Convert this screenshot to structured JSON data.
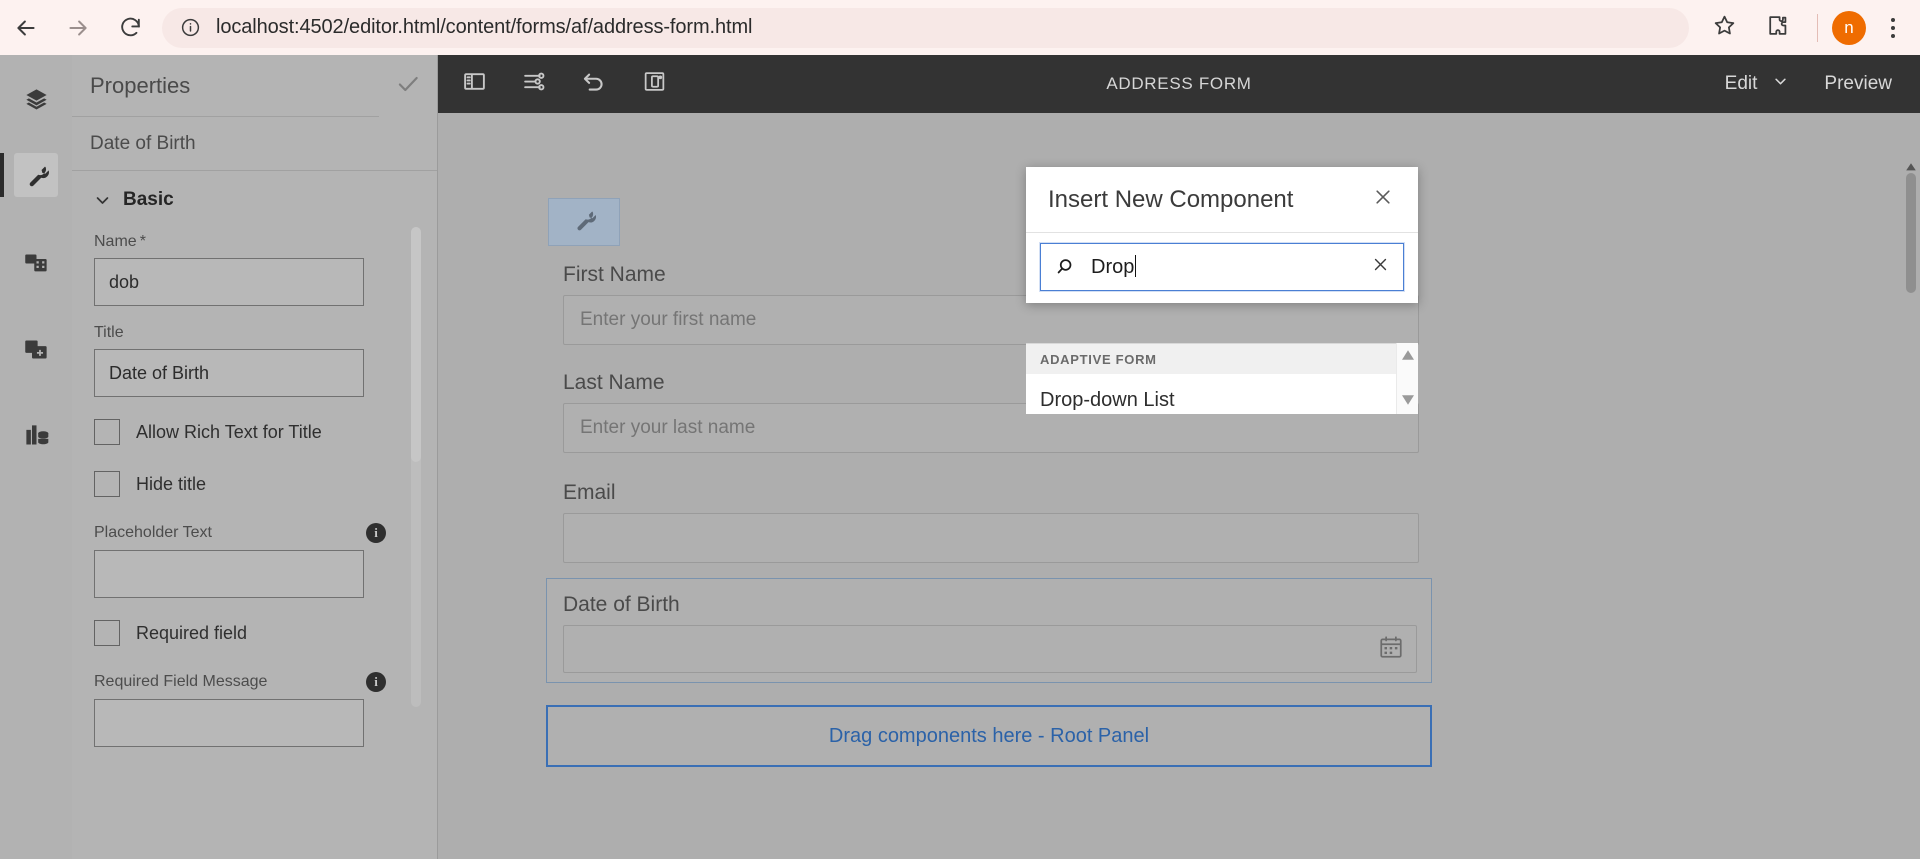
{
  "browser": {
    "url": "localhost:4502/editor.html/content/forms/af/address-form.html",
    "back_icon": "back-arrow-icon",
    "forward_icon": "forward-arrow-icon",
    "reload_icon": "reload-icon",
    "info_icon": "site-info-icon",
    "bookmark_icon": "star-icon",
    "extensions_icon": "puzzle-piece-icon",
    "profile_initial": "n",
    "menu_icon": "kebab-menu-icon"
  },
  "rail": {
    "items": [
      {
        "name": "layers",
        "icon": "layers-icon",
        "active": false
      },
      {
        "name": "edit",
        "icon": "wrench-icon",
        "active": true
      },
      {
        "name": "assets",
        "icon": "assets-finder-icon",
        "active": false
      },
      {
        "name": "components",
        "icon": "add-component-icon",
        "active": false
      },
      {
        "name": "content-tree",
        "icon": "content-tree-icon",
        "active": false
      }
    ]
  },
  "properties": {
    "title": "Properties",
    "close_icon": "close-icon",
    "done_icon": "check-icon",
    "component_name": "Date of Birth",
    "section": {
      "label": "Basic",
      "expanded": true,
      "chevron": "chevron-down-icon"
    },
    "fields": [
      {
        "label": "Name",
        "required_mark": "*",
        "value": "dob",
        "type": "text"
      },
      {
        "label": "Title",
        "required_mark": "",
        "value": "Date of Birth",
        "type": "text"
      },
      {
        "label": "Allow Rich Text for Title",
        "checked": false,
        "type": "checkbox"
      },
      {
        "label": "Hide title",
        "checked": false,
        "type": "checkbox"
      },
      {
        "label": "Placeholder Text",
        "value": "",
        "type": "text",
        "info": true
      },
      {
        "label": "Required field",
        "checked": false,
        "type": "checkbox"
      },
      {
        "label": "Required Field Message",
        "value": "",
        "type": "text",
        "info": true
      }
    ]
  },
  "toolbar": {
    "page_title": "ADDRESS FORM",
    "buttons": [
      {
        "name": "side-panel-toggle",
        "icon": "side-panel-icon"
      },
      {
        "name": "page-information",
        "icon": "sliders-icon"
      },
      {
        "name": "undo",
        "icon": "undo-icon"
      },
      {
        "name": "emulator",
        "icon": "device-emulator-icon"
      }
    ],
    "mode_label": "Edit",
    "mode_chevron": "chevron-down-icon",
    "preview_label": "Preview"
  },
  "canvas": {
    "edit_chip_icon": "wrench-icon",
    "fields": [
      {
        "label": "First Name",
        "placeholder": "Enter your first name"
      },
      {
        "label": "Last Name",
        "placeholder": "Enter your last name"
      },
      {
        "label": "Email",
        "placeholder": ""
      }
    ],
    "selected_field": {
      "label": "Date of Birth",
      "placeholder": "",
      "icon": "calendar-icon"
    },
    "drop_zone_label": "Drag components here - Root Panel",
    "drop_zone_color": "#2b62a8",
    "selection_border_color": "#7a93ae"
  },
  "modal": {
    "title": "Insert New Component",
    "close_icon": "close-icon",
    "search": {
      "icon": "search-icon",
      "value": "Drop",
      "placeholder": "",
      "clear_icon": "clear-icon",
      "focus_color": "#4a7fd4"
    },
    "results": {
      "group_label": "ADAPTIVE FORM",
      "items": [
        {
          "label": "Drop-down List"
        }
      ],
      "scroll_up_icon": "triangle-up-icon",
      "scroll_down_icon": "triangle-down-icon"
    }
  }
}
